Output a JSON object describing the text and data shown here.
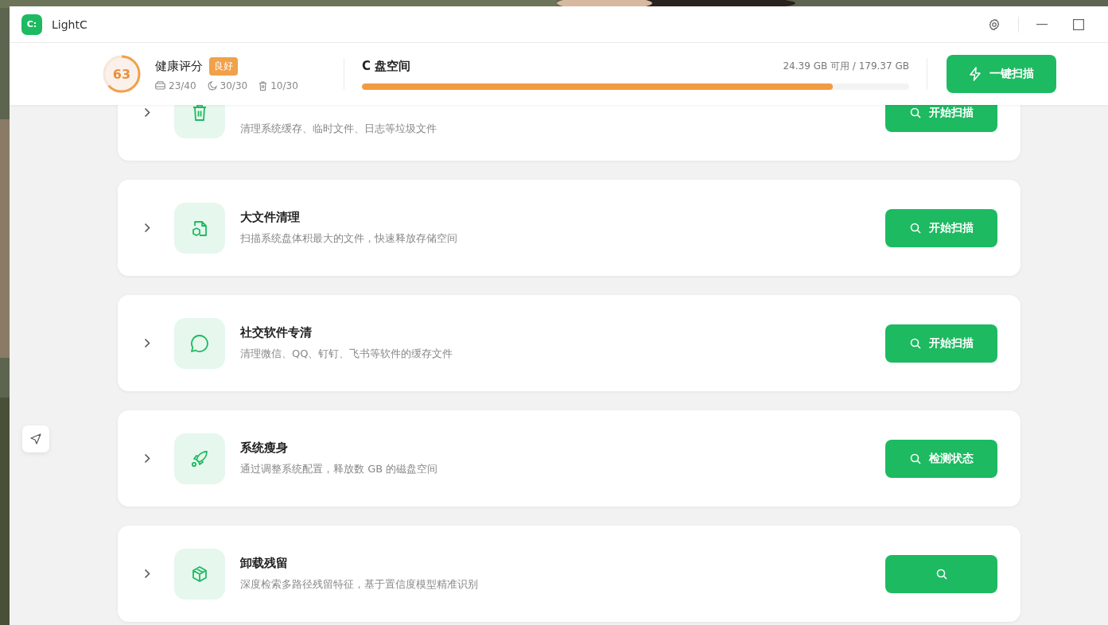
{
  "window": {
    "title": "LightC",
    "logo": "C:"
  },
  "health": {
    "score": "63",
    "level": 0.63,
    "label": "健康评分",
    "badge": "良好",
    "stats": [
      {
        "kind": "disk",
        "value": "23/40"
      },
      {
        "kind": "moon",
        "value": "30/30"
      },
      {
        "kind": "trash",
        "value": "10/30"
      }
    ]
  },
  "disk": {
    "title": "C 盘空间",
    "usage": "24.39 GB 可用 / 179.37 GB",
    "level": 0.86
  },
  "scan_all_button": "一键扫描",
  "cards": [
    {
      "kind": "trash",
      "description": "清理系统缓存、临时文件、日志等垃圾文件",
      "button": "开始扫描"
    },
    {
      "kind": "file",
      "title": "大文件清理",
      "description": "扫描系统盘体积最大的文件，快速释放存储空间",
      "button": "开始扫描"
    },
    {
      "kind": "chat",
      "title": "社交软件专清",
      "description": "清理微信、QQ、钉钉、飞书等软件的缓存文件",
      "button": "开始扫描"
    },
    {
      "kind": "rocket",
      "title": "系统瘦身",
      "description": "通过调整系统配置，释放数 GB 的磁盘空间",
      "button": "检测状态"
    },
    {
      "kind": "box",
      "title": "卸载残留",
      "description": "深度检索多路径残留特征，基于置信度模型精准识别"
    }
  ]
}
